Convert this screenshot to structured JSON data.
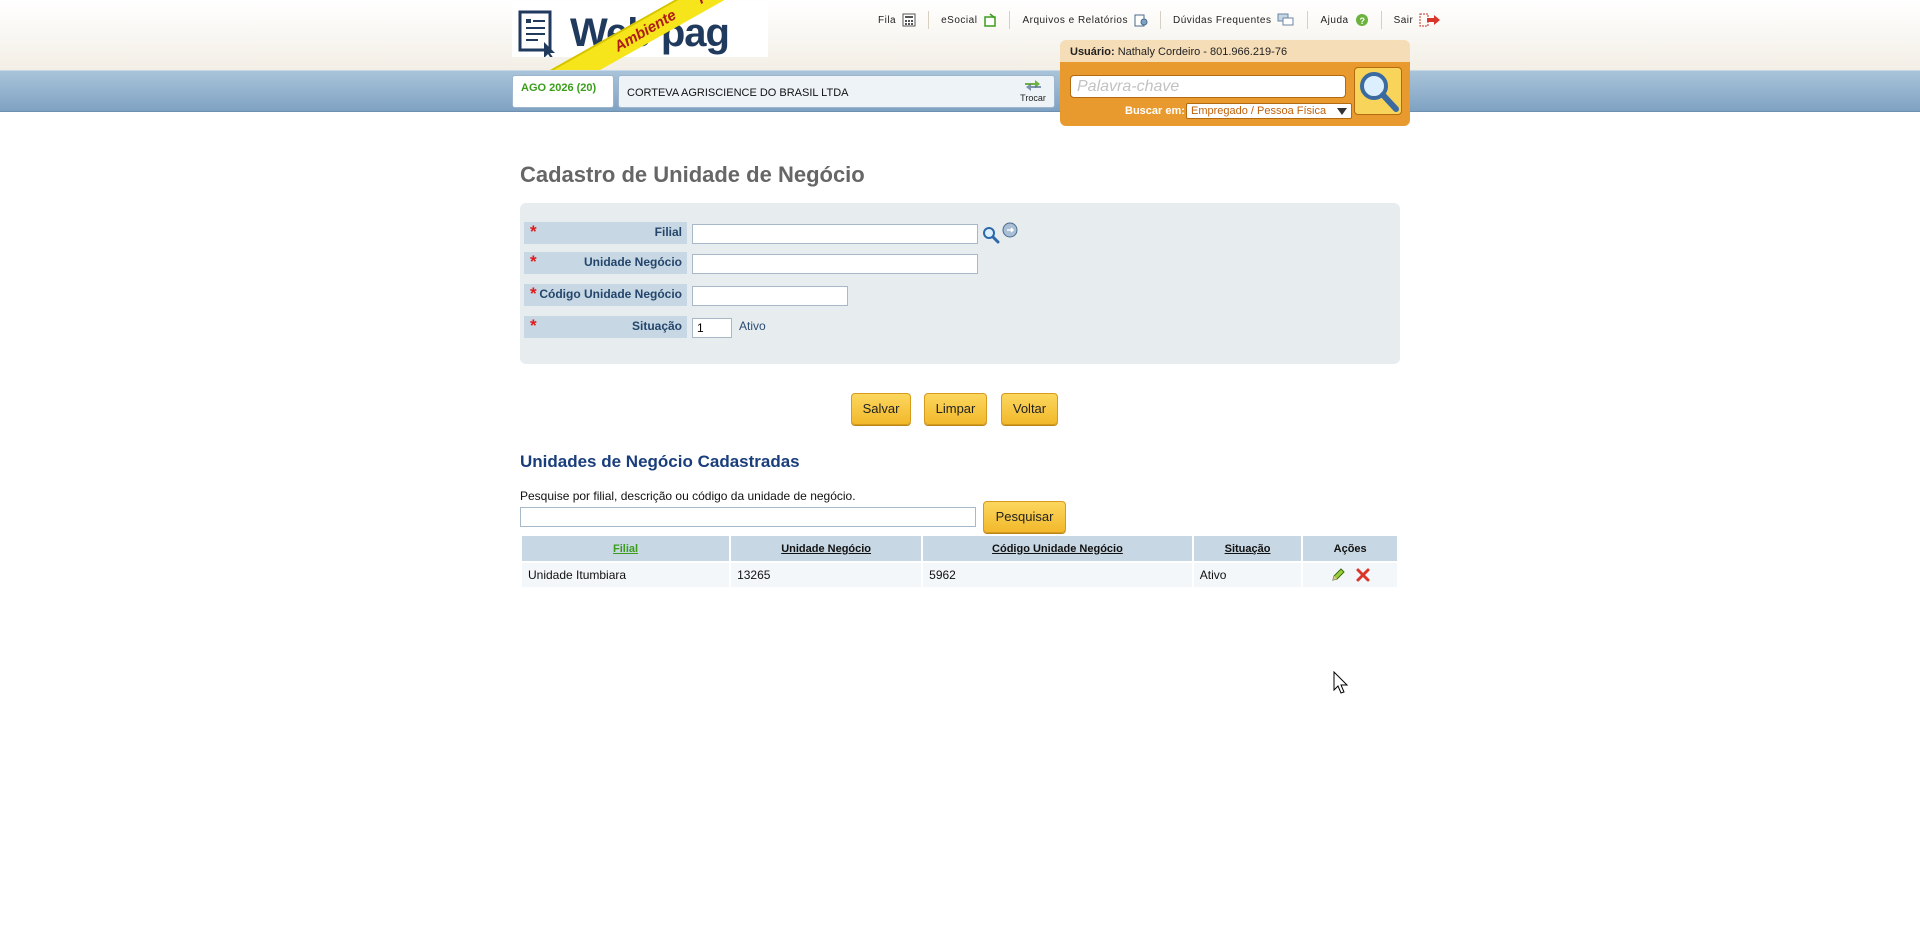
{
  "header": {
    "logo_text": "Web pag",
    "ribbon_text": "Ambiente      Teste",
    "links": [
      {
        "label": "Fila",
        "icon": "calculator-icon"
      },
      {
        "label": "eSocial",
        "icon": "esocial-icon"
      },
      {
        "label": "Arquivos e Relatórios",
        "icon": "report-icon"
      },
      {
        "label": "Dúvidas Frequentes",
        "icon": "faq-icon"
      },
      {
        "label": "Ajuda",
        "icon": "help-icon"
      },
      {
        "label": "Sair",
        "icon": "exit-icon"
      }
    ],
    "user_label": "Usuário:",
    "user_value": "Nathaly Cordeiro - 801.966.219-76",
    "search_placeholder": "Palavra-chave",
    "search_in_label": "Buscar em:",
    "search_in_value": "Empregado / Pessoa Física",
    "period": "AGO 2026 (20)",
    "company": "CORTEVA AGRISCIENCE DO BRASIL LTDA",
    "switch_label": "Trocar"
  },
  "page": {
    "title": "Cadastro de Unidade de Negócio"
  },
  "form": {
    "filial_label": "Filial",
    "filial_value": "",
    "unidade_label": "Unidade Negócio",
    "unidade_value": "",
    "codigo_label": "Código Unidade Negócio",
    "codigo_value": "",
    "situacao_label": "Situação",
    "situacao_value": "1",
    "situacao_text": "Ativo",
    "required_mark": "*"
  },
  "actions": {
    "save": "Salvar",
    "clear": "Limpar",
    "back": "Voltar"
  },
  "list": {
    "title": "Unidades de Negócio Cadastradas",
    "hint": "Pesquise por filial, descrição ou código da unidade de negócio.",
    "search_button": "Pesquisar",
    "columns": [
      "Filial",
      "Unidade Negócio",
      "Código Unidade Negócio",
      "Situação",
      "Ações"
    ],
    "rows": [
      {
        "filial": "Unidade Itumbiara",
        "unidade": "13265",
        "codigo": "5962",
        "situacao": "Ativo"
      }
    ]
  },
  "colors": {
    "accent_orange": "#e99a2e",
    "header_blue": "#7fa2c2",
    "button_yellow": "#f2b92b",
    "title_blue": "#1a3e7c",
    "required_red": "#e01a1a",
    "ok_green": "#3a9e1c"
  }
}
